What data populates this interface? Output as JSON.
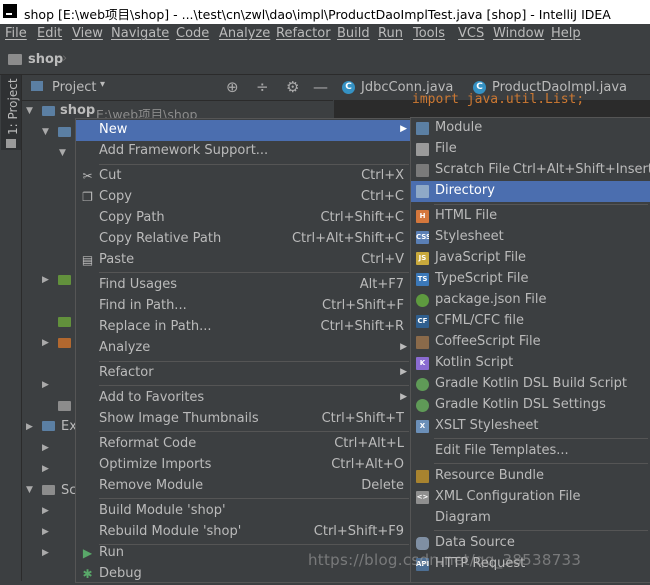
{
  "window": {
    "title": "shop [E:\\web项目\\shop] - ...\\test\\cn\\zwl\\dao\\impl\\ProductDaoImplTest.java [shop] - IntelliJ IDEA"
  },
  "menubar": {
    "items": [
      "File",
      "Edit",
      "View",
      "Navigate",
      "Code",
      "Analyze",
      "Refactor",
      "Build",
      "Run",
      "Tools",
      "VCS",
      "Window",
      "Help"
    ]
  },
  "navbar": {
    "crumb": "shop",
    "separator": "›"
  },
  "side_strip": {
    "tab_label": "1: Project"
  },
  "project_panel": {
    "label": "Project",
    "dropdown": "▾",
    "actions": [
      "⊕",
      "÷",
      "⚙",
      "—"
    ],
    "root_name": "shop",
    "root_path": "E:\\web项目\\shop",
    "truncated": [
      "Ex",
      "Sc"
    ]
  },
  "editor": {
    "tabs": [
      {
        "icon": "C",
        "label": "JdbcConn.java"
      },
      {
        "icon": "C",
        "label": "ProductDaoImpl.java"
      }
    ],
    "code_fragment": "import java.util.List;"
  },
  "context_menu": {
    "items": [
      {
        "label": "New",
        "shortcut": "",
        "submenu": true,
        "highlighted": true,
        "icon": ""
      },
      {
        "label": "Add Framework Support...",
        "shortcut": "",
        "icon": ""
      },
      {
        "label": "Cut",
        "shortcut": "Ctrl+X",
        "icon": "scissors-icon"
      },
      {
        "label": "Copy",
        "shortcut": "Ctrl+C",
        "icon": "copy-icon"
      },
      {
        "label": "Copy Path",
        "shortcut": "Ctrl+Shift+C",
        "icon": ""
      },
      {
        "label": "Copy Relative Path",
        "shortcut": "Ctrl+Alt+Shift+C",
        "icon": ""
      },
      {
        "label": "Paste",
        "shortcut": "Ctrl+V",
        "icon": "paste-icon"
      },
      {
        "label": "Find Usages",
        "shortcut": "Alt+F7",
        "icon": ""
      },
      {
        "label": "Find in Path...",
        "shortcut": "Ctrl+Shift+F",
        "icon": ""
      },
      {
        "label": "Replace in Path...",
        "shortcut": "Ctrl+Shift+R",
        "icon": ""
      },
      {
        "label": "Analyze",
        "shortcut": "",
        "submenu": true,
        "icon": ""
      },
      {
        "label": "Refactor",
        "shortcut": "",
        "submenu": true,
        "icon": ""
      },
      {
        "label": "Add to Favorites",
        "shortcut": "",
        "submenu": true,
        "icon": ""
      },
      {
        "label": "Show Image Thumbnails",
        "shortcut": "Ctrl+Shift+T",
        "icon": ""
      },
      {
        "label": "Reformat Code",
        "shortcut": "Ctrl+Alt+L",
        "icon": ""
      },
      {
        "label": "Optimize Imports",
        "shortcut": "Ctrl+Alt+O",
        "icon": ""
      },
      {
        "label": "Remove Module",
        "shortcut": "Delete",
        "icon": ""
      },
      {
        "label": "Build Module 'shop'",
        "shortcut": "",
        "icon": ""
      },
      {
        "label": "Rebuild Module 'shop'",
        "shortcut": "Ctrl+Shift+F9",
        "icon": ""
      },
      {
        "label": "Run",
        "shortcut": "",
        "icon": "run-icon"
      },
      {
        "label": "Debug",
        "shortcut": "",
        "icon": "debug-icon"
      }
    ]
  },
  "new_submenu": {
    "items": [
      {
        "label": "Module",
        "shortcut": "",
        "icon": "module-icon"
      },
      {
        "label": "File",
        "shortcut": "",
        "icon": "file-icon"
      },
      {
        "label": "Scratch File",
        "shortcut": "Ctrl+Alt+Shift+Insert",
        "icon": "scratch-file-icon"
      },
      {
        "label": "Directory",
        "shortcut": "",
        "highlighted": true,
        "icon": "directory-icon"
      },
      {
        "label": "HTML File",
        "shortcut": "",
        "icon": "html-file-icon"
      },
      {
        "label": "Stylesheet",
        "shortcut": "",
        "icon": "css-file-icon"
      },
      {
        "label": "JavaScript File",
        "shortcut": "",
        "icon": "javascript-file-icon"
      },
      {
        "label": "TypeScript File",
        "shortcut": "",
        "icon": "typescript-file-icon"
      },
      {
        "label": "package.json File",
        "shortcut": "",
        "icon": "nodejs-icon"
      },
      {
        "label": "CFML/CFC file",
        "shortcut": "",
        "icon": "cfml-file-icon"
      },
      {
        "label": "CoffeeScript File",
        "shortcut": "",
        "icon": "coffeescript-file-icon"
      },
      {
        "label": "Kotlin Script",
        "shortcut": "",
        "icon": "kotlin-icon"
      },
      {
        "label": "Gradle Kotlin DSL Build Script",
        "shortcut": "",
        "icon": "gradle-icon"
      },
      {
        "label": "Gradle Kotlin DSL Settings",
        "shortcut": "",
        "icon": "gradle-icon"
      },
      {
        "label": "XSLT Stylesheet",
        "shortcut": "",
        "icon": "xslt-file-icon"
      },
      {
        "label": "Edit File Templates...",
        "shortcut": "",
        "icon": ""
      },
      {
        "label": "Resource Bundle",
        "shortcut": "",
        "icon": "resource-bundle-icon"
      },
      {
        "label": "XML Configuration File",
        "shortcut": "",
        "submenu": true,
        "icon": "xml-file-icon"
      },
      {
        "label": "Diagram",
        "shortcut": "",
        "submenu": true,
        "icon": ""
      },
      {
        "label": "Data Source",
        "shortcut": "",
        "submenu": true,
        "icon": "database-icon"
      },
      {
        "label": "HTTP Request",
        "shortcut": "",
        "icon": "http-request-icon"
      }
    ]
  },
  "watermark": "https://blog.csdn.net/qq_38538733",
  "colors": {
    "background": "#3c3f41",
    "editor_background": "#2b2b2b",
    "highlight": "#4b6eaf",
    "text": "#bbbbbb",
    "folder_blue": "#5b7fa3",
    "folder_green": "#62913c",
    "folder_orange": "#b2682f"
  }
}
